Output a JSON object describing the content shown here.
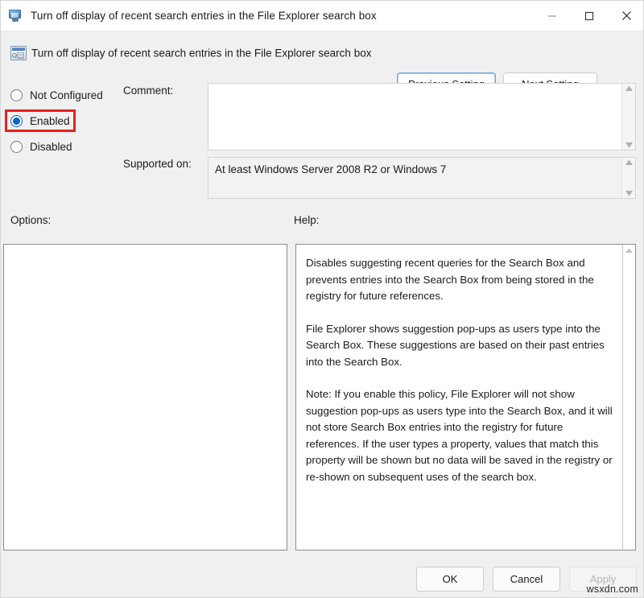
{
  "window": {
    "title": "Turn off display of recent search entries in the File Explorer search box",
    "title_icon": "policy-monitor-icon",
    "controls": {
      "minimize": "minimize-icon",
      "maximize": "maximize-icon",
      "close": "close-icon"
    }
  },
  "header": {
    "icon": "group-policy-setting-icon",
    "title": "Turn off display of recent search entries in the File Explorer search box",
    "previous_setting_label": "Previous Setting",
    "next_setting_label": "Next Setting"
  },
  "state": {
    "options": [
      {
        "label": "Not Configured",
        "checked": false
      },
      {
        "label": "Enabled",
        "checked": true
      },
      {
        "label": "Disabled",
        "checked": false
      }
    ],
    "selected": "Enabled",
    "highlight_color": "#e8201f"
  },
  "comment": {
    "label": "Comment:",
    "value": "",
    "placeholder": ""
  },
  "supported": {
    "label": "Supported on:",
    "value": "At least Windows Server 2008 R2 or Windows 7"
  },
  "panels": {
    "options_label": "Options:",
    "help_label": "Help:",
    "options_content": "",
    "help_paragraphs": [
      "Disables suggesting recent queries for the Search Box and prevents entries into the Search Box from being stored in the registry for future references.",
      "File Explorer shows suggestion pop-ups as users type into the Search Box.  These suggestions are based on their past entries into the Search Box.",
      "Note: If you enable this policy, File Explorer will not show suggestion pop-ups as users type into the Search Box, and it will not store Search Box entries into the registry for future references.  If the user types a property, values that match this property will be shown but no data will be saved in the registry or re-shown on subsequent uses of the search box."
    ]
  },
  "footer": {
    "ok_label": "OK",
    "cancel_label": "Cancel",
    "apply_label": "Apply",
    "apply_enabled": false
  },
  "watermark": "wsxdn.com",
  "scrollbars": {
    "up_arrow_icon": "triangle-up-icon",
    "down_arrow_icon": "triangle-down-icon"
  }
}
